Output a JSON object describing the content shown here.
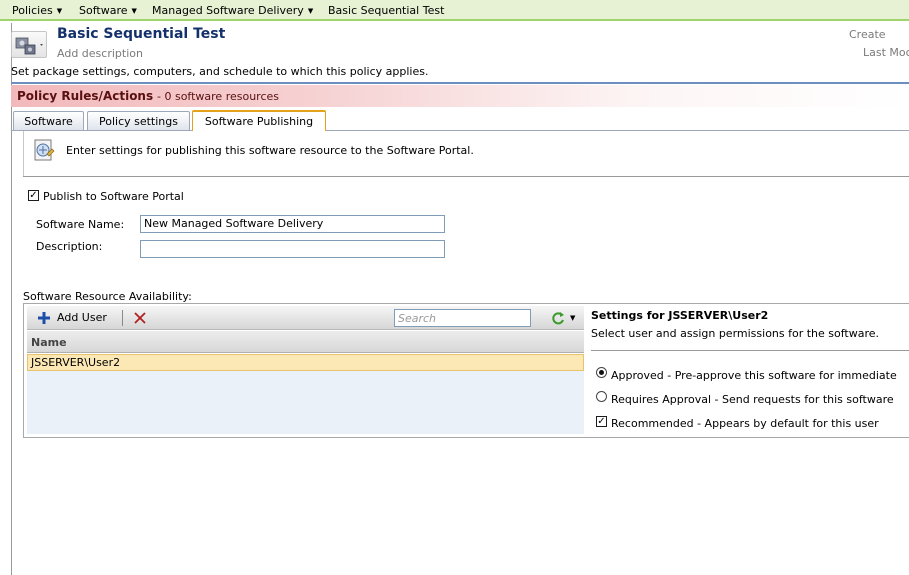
{
  "breadcrumb": {
    "items": [
      {
        "label": "Policies",
        "arrow": "▼"
      },
      {
        "label": "Software",
        "arrow": "▼"
      },
      {
        "label": "Managed Software Delivery",
        "arrow": "▼"
      },
      {
        "label": "Basic Sequential Test",
        "arrow": ""
      }
    ]
  },
  "header": {
    "title": "Basic Sequential Test",
    "add_description": "Add description",
    "created_label": "Create",
    "last_modified_label": "Last Moc",
    "package_text": "Set package settings, computers, and schedule to which this policy applies."
  },
  "rules": {
    "title": "Policy Rules/Actions",
    "count": "- 0 software resources"
  },
  "tabs": [
    {
      "label": "Software",
      "active": false
    },
    {
      "label": "Policy settings",
      "active": false
    },
    {
      "label": "Software Publishing",
      "active": true
    }
  ],
  "publishing": {
    "info_text": "Enter settings for publishing this software resource to the Software Portal.",
    "publish_label": "Publish to Software Portal",
    "publish_checked": true,
    "software_name_label": "Software Name:",
    "software_name_value": "New Managed Software Delivery",
    "description_label": "Description:",
    "description_value": "",
    "availability_label": "Software Resource Availability:"
  },
  "grid": {
    "add_user_label": "Add User",
    "search_placeholder": "Search",
    "column_name": "Name",
    "rows": [
      "JSSERVER\\User2"
    ]
  },
  "settings": {
    "title": "Settings for JSSERVER\\User2",
    "subtitle": "Select user and assign permissions for the software.",
    "approved_label": "Approved - Pre-approve this software for immediate",
    "requires_label": "Requires Approval - Send requests for this software",
    "recommended_label": "Recommended - Appears by default for this user",
    "approved_selected": true,
    "recommended_checked": true
  },
  "colors": {
    "accent_green": "#9fd36b",
    "title_blue": "#15316b",
    "rules_band": "#f2b9bb",
    "active_tab": "#e3a21a",
    "selected_row": "#fce8b4"
  }
}
